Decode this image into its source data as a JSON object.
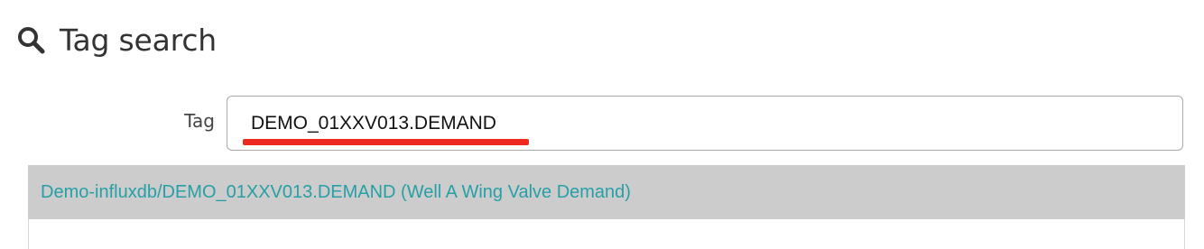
{
  "header": {
    "icon": "search-icon",
    "title": "Tag search"
  },
  "form": {
    "tag_label": "Tag",
    "tag_value": "DEMO_01XXV013.DEMAND"
  },
  "suggestions": [
    {
      "label": "Demo-influxdb/DEMO_01XXV013.DEMAND (Well A Wing Valve Demand)"
    }
  ],
  "colors": {
    "highlight": "#ee2a1e",
    "link": "#26a0a6",
    "selected_row": "#cccccc"
  }
}
